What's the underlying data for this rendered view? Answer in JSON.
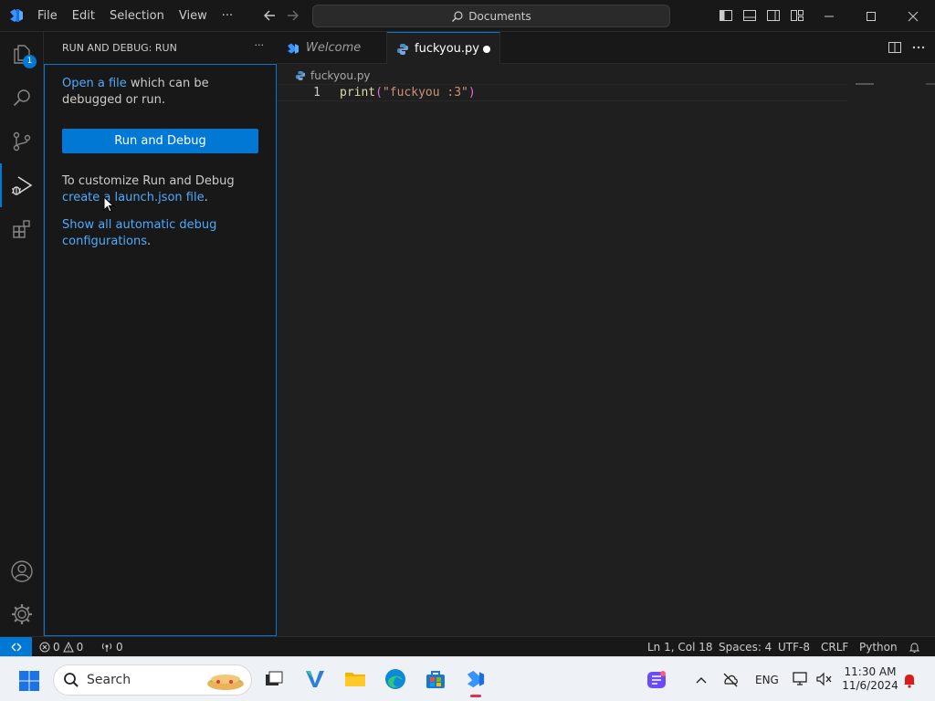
{
  "titlebar": {
    "menu": [
      "File",
      "Edit",
      "Selection",
      "View",
      "···"
    ],
    "command_center": "Documents"
  },
  "activitybar": {
    "explorer_badge": "1"
  },
  "sidebar": {
    "title": "RUN AND DEBUG: RUN",
    "more": "···",
    "open_file_link": "Open a file",
    "open_file_rest": " which can be debugged or run.",
    "run_button": "Run and Debug",
    "customize_text": "To customize Run and Debug ",
    "customize_link": "create a launch.json file",
    "customize_end": ".",
    "show_all_link": "Show all automatic debug configurations",
    "show_all_end": "."
  },
  "tabs": [
    {
      "label": "Welcome"
    },
    {
      "label": "fuckyou.py"
    }
  ],
  "editor": {
    "breadcrumb": "fuckyou.py",
    "line_number": "1",
    "code_fn": "print",
    "code_open": "(",
    "code_str": "\"fuckyou :3\"",
    "code_close": ")"
  },
  "statusbar": {
    "errors": "0",
    "warnings": "0",
    "ports": "0",
    "position": "Ln 1, Col 18",
    "spaces": "Spaces: 4",
    "encoding": "UTF-8",
    "eol": "CRLF",
    "language": "Python"
  },
  "taskbar": {
    "search_label": "Search",
    "language": "ENG",
    "time": "11:30 AM",
    "date": "11/6/2024"
  },
  "colors": {
    "accent": "#0078d4",
    "link": "#4daafc",
    "string": "#ce9178",
    "function": "#dcdcaa"
  }
}
